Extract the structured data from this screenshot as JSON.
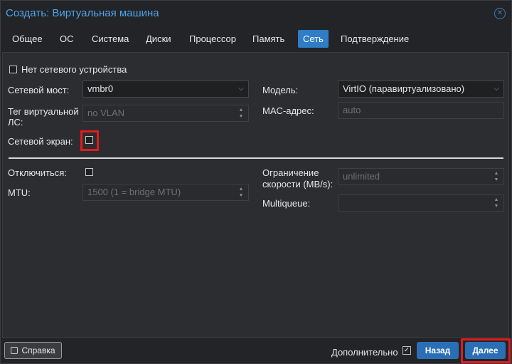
{
  "window": {
    "title": "Создать: Виртуальная машина"
  },
  "tabs": [
    {
      "label": "Общее"
    },
    {
      "label": "ОС"
    },
    {
      "label": "Система"
    },
    {
      "label": "Диски"
    },
    {
      "label": "Процессор"
    },
    {
      "label": "Память"
    },
    {
      "label": "Сеть",
      "active": true
    },
    {
      "label": "Подтверждение"
    }
  ],
  "form": {
    "no_network_label": "Нет сетевого устройства",
    "bridge_label": "Сетевой мост:",
    "bridge_value": "vmbr0",
    "vlan_label": "Тег виртуальной ЛС:",
    "vlan_label_line1": "Тег виртуальной",
    "vlan_label_line2": "ЛС:",
    "vlan_placeholder": "no VLAN",
    "firewall_label": "Сетевой экран:",
    "model_label": "Модель:",
    "model_value": "VirtIO (паравиртуализовано)",
    "mac_label": "MAC-адрес:",
    "mac_placeholder": "auto",
    "disconnect_label": "Отключиться:",
    "mtu_label": "MTU:",
    "mtu_placeholder": "1500 (1 = bridge MTU)",
    "rate_label_line1": "Ограничение",
    "rate_label_line2": "скорости (MB/s):",
    "rate_placeholder": "unlimited",
    "multiqueue_label": "Multiqueue:",
    "multiqueue_value": ""
  },
  "footer": {
    "help_label": "Справка",
    "advanced_label": "Дополнительно",
    "back_label": "Назад",
    "next_label": "Далее"
  },
  "colors": {
    "accent": "#2e7dc6",
    "highlight": "#e21b1b",
    "title": "#4fa3e8"
  }
}
